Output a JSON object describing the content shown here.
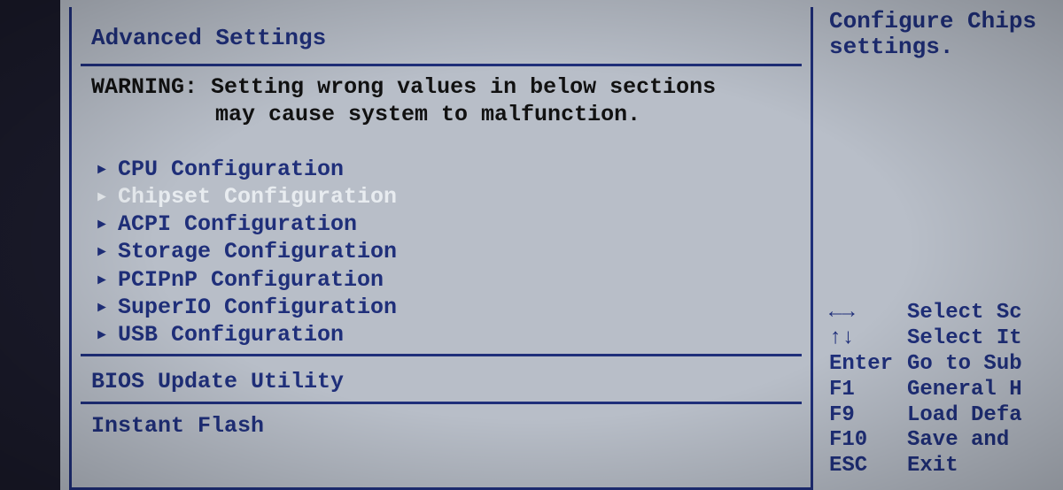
{
  "title": "Advanced Settings",
  "warning": {
    "label": "WARNING:",
    "line1": "Setting wrong values in below sections",
    "line2": "may cause system to malfunction."
  },
  "menu": {
    "items": [
      {
        "label": "CPU Configuration",
        "selected": false
      },
      {
        "label": "Chipset Configuration",
        "selected": true
      },
      {
        "label": "ACPI Configuration",
        "selected": false
      },
      {
        "label": "Storage Configuration",
        "selected": false
      },
      {
        "label": "PCIPnP Configuration",
        "selected": false
      },
      {
        "label": "SuperIO Configuration",
        "selected": false
      },
      {
        "label": "USB Configuration",
        "selected": false
      }
    ]
  },
  "sectionLabel": "BIOS Update Utility",
  "subItem": "Instant Flash",
  "help": {
    "description_line1": "Configure Chips",
    "description_line2": "settings.",
    "keys": [
      {
        "key": "←→",
        "desc": "Select Sc"
      },
      {
        "key": "↑↓",
        "desc": "Select It"
      },
      {
        "key": "Enter",
        "desc": "Go to Sub"
      },
      {
        "key": "F1",
        "desc": "General H"
      },
      {
        "key": "F9",
        "desc": "Load Defa"
      },
      {
        "key": "F10",
        "desc": "Save and "
      },
      {
        "key": "ESC",
        "desc": "Exit"
      }
    ]
  }
}
